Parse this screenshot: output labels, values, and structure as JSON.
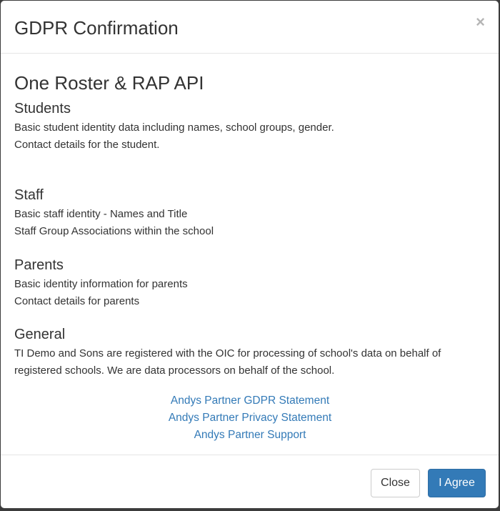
{
  "modal": {
    "title": "GDPR Confirmation",
    "close_glyph": "×"
  },
  "body": {
    "api_title": "One Roster & RAP API",
    "sections": [
      {
        "heading": "Students",
        "lines": [
          "Basic student identity data including names, school groups, gender.",
          "Contact details for the student."
        ]
      },
      {
        "heading": "Staff",
        "lines": [
          "Basic staff identity - Names and Title",
          "Staff Group Associations within the school"
        ]
      },
      {
        "heading": "Parents",
        "lines": [
          "Basic identity information for parents",
          "Contact details for parents"
        ]
      },
      {
        "heading": "General",
        "paragraph": "TI Demo and Sons are registered with the OIC for processing of school's data on behalf of registered schools.  We are data processors on behalf of the school."
      }
    ],
    "links": [
      "Andys Partner GDPR Statement",
      "Andys Partner Privacy Statement",
      "Andys Partner Support"
    ]
  },
  "footer": {
    "close_label": "Close",
    "agree_label": "I Agree"
  },
  "colors": {
    "primary": "#337ab7",
    "text": "#333333",
    "backdrop": "#3c3c3c"
  }
}
